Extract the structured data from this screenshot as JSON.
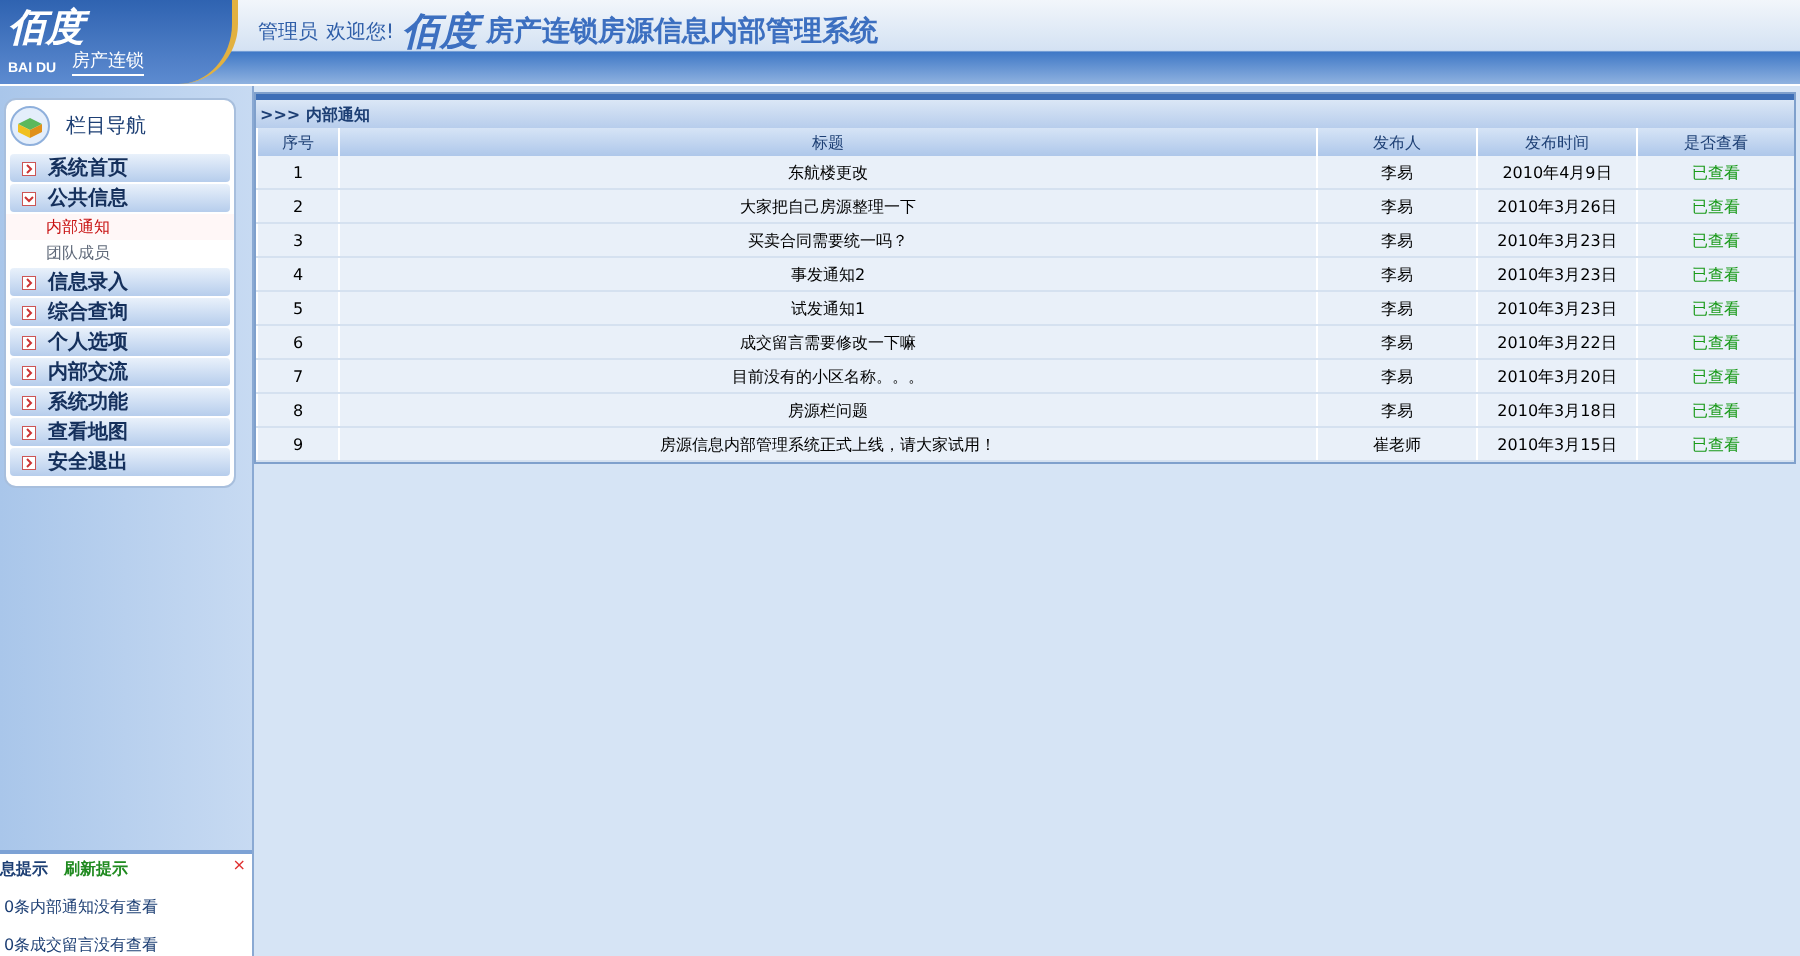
{
  "logo": {
    "name": "佰度",
    "latin": "BAI DU",
    "tagline": "房产连锁"
  },
  "header": {
    "user": "管理员",
    "welcome": "欢迎您!",
    "brand": "佰度",
    "system_title": "房产连锁房源信息内部管理系统"
  },
  "sidebar": {
    "title": "栏目导航",
    "items": [
      {
        "label": "系统首页",
        "expanded": false
      },
      {
        "label": "公共信息",
        "expanded": true,
        "children": [
          {
            "label": "内部通知",
            "selected": true
          },
          {
            "label": "团队成员",
            "selected": false
          }
        ]
      },
      {
        "label": "信息录入",
        "expanded": false
      },
      {
        "label": "综合查询",
        "expanded": false
      },
      {
        "label": "个人选项",
        "expanded": false
      },
      {
        "label": "内部交流",
        "expanded": false
      },
      {
        "label": "系统功能",
        "expanded": false
      },
      {
        "label": "查看地图",
        "expanded": false
      },
      {
        "label": "安全退出",
        "expanded": false
      }
    ]
  },
  "message_box": {
    "title": "息提示",
    "refresh": "刷新提示",
    "close": "×",
    "lines": [
      "0条内部通知没有查看",
      "0条成交留言没有查看"
    ]
  },
  "panel": {
    "breadcrumb": ">>> 内部通知",
    "table": {
      "columns": [
        "序号",
        "标题",
        "发布人",
        "发布时间",
        "是否查看"
      ],
      "rows": [
        [
          "1",
          "东航楼更改",
          "李易",
          "2010年4月9日",
          "已查看"
        ],
        [
          "2",
          "大家把自己房源整理一下",
          "李易",
          "2010年3月26日",
          "已查看"
        ],
        [
          "3",
          "买卖合同需要统一吗？",
          "李易",
          "2010年3月23日",
          "已查看"
        ],
        [
          "4",
          "事发通知2",
          "李易",
          "2010年3月23日",
          "已查看"
        ],
        [
          "5",
          "试发通知1",
          "李易",
          "2010年3月23日",
          "已查看"
        ],
        [
          "6",
          "成交留言需要修改一下嘛",
          "李易",
          "2010年3月22日",
          "已查看"
        ],
        [
          "7",
          "目前没有的小区名称。。。",
          "李易",
          "2010年3月20日",
          "已查看"
        ],
        [
          "8",
          "房源栏问题",
          "李易",
          "2010年3月18日",
          "已查看"
        ],
        [
          "9",
          "房源信息内部管理系统正式上线，请大家试用！",
          "崔老师",
          "2010年3月15日",
          "已查看"
        ]
      ]
    }
  }
}
